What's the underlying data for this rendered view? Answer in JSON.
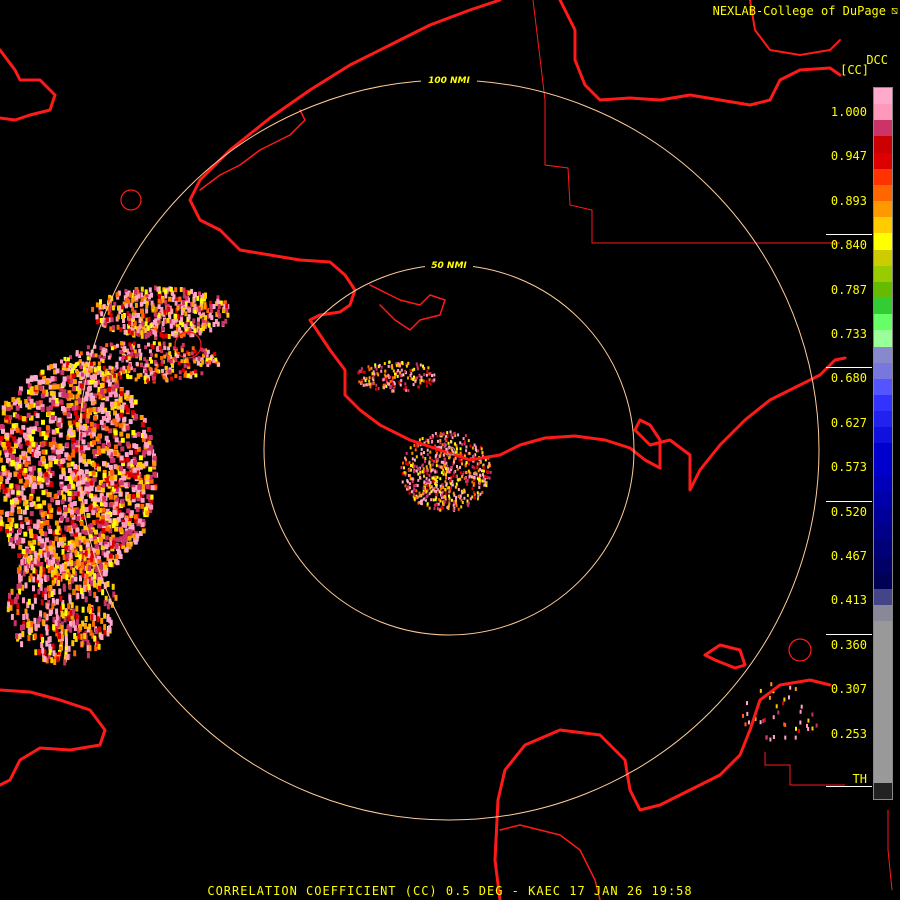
{
  "header": {
    "credit": "NEXLAB-College of DuPage",
    "logo_glyph": "⧅"
  },
  "legend": {
    "product_code": "DCC",
    "unit": "[CC]",
    "threshold_label": "TH",
    "ticks": [
      "1.000",
      "0.947",
      "0.893",
      "0.840",
      "0.787",
      "0.733",
      "0.680",
      "0.627",
      "0.573",
      "0.520",
      "0.467",
      "0.413",
      "0.360",
      "0.307",
      "0.253"
    ],
    "colors": [
      "#ffaacc",
      "#ff99bb",
      "#cc3366",
      "#cc0000",
      "#dd0000",
      "#ff3300",
      "#ff6600",
      "#ff9900",
      "#ffcc00",
      "#ffff00",
      "#cccc00",
      "#99cc00",
      "#66bb00",
      "#33cc33",
      "#66ff66",
      "#99ff99",
      "#8888cc",
      "#7777dd",
      "#5555ff",
      "#3333ff",
      "#2222ee",
      "#1111dd",
      "#0000cc",
      "#0000cc",
      "#0000bb",
      "#0000aa",
      "#000099",
      "#000088",
      "#000077",
      "#000066",
      "#000055",
      "#444488",
      "#888899",
      "#999999",
      "#999999",
      "#999999",
      "#999999",
      "#999999",
      "#999999",
      "#999999",
      "#999999",
      "#999999",
      "#999999",
      "#222222"
    ]
  },
  "range_rings": [
    "50 NMI",
    "100 NMI"
  ],
  "footer": {
    "caption": "CORRELATION COEFFICIENT (CC) 0.5 DEG - KAEC 17 JAN 26 19:58"
  },
  "colors": {
    "coastline": "#ff1a1a",
    "ring": "#ffcc99",
    "label": "#ffff00",
    "background": "#000000"
  }
}
